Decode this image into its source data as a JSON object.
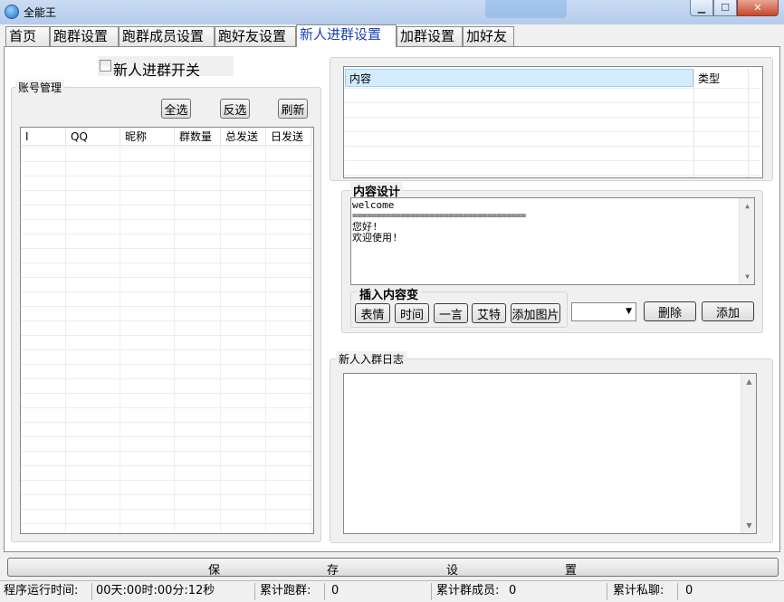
{
  "window": {
    "title": "全能王",
    "min_label": "▁",
    "max_label": "☐",
    "close_label": "✕"
  },
  "tabs": [
    {
      "label": "首页"
    },
    {
      "label": "跑群设置"
    },
    {
      "label": "跑群成员设置"
    },
    {
      "label": "跑好友设置"
    },
    {
      "label": "新人进群设置"
    },
    {
      "label": "加群设置"
    },
    {
      "label": "加好友"
    }
  ],
  "active_tab": "新人进群设置",
  "switch": {
    "label": "新人进群开关",
    "checked": false
  },
  "account": {
    "legend": "账号管理",
    "select_all": "全选",
    "invert": "反选",
    "refresh": "刷新",
    "columns": [
      "I",
      "QQ",
      "昵称",
      "群数量",
      "总发送",
      "日发送"
    ]
  },
  "content_table": {
    "columns": [
      "内容",
      "类型"
    ]
  },
  "design": {
    "legend": "内容设计",
    "text_lines": [
      "welcome",
      "====================================",
      "您好!",
      "欢迎使用!"
    ],
    "insert_legend": "插入内容变",
    "insert_buttons": [
      "表情",
      "时间",
      "一言",
      "艾特",
      "添加图片"
    ],
    "select_value": "",
    "delete": "删除",
    "add": "添加"
  },
  "log": {
    "legend": "新人入群日志"
  },
  "save": {
    "chars": [
      "保",
      "存",
      "设",
      "置"
    ]
  },
  "status": {
    "runtime_label": "程序运行时间:",
    "runtime_value": "00天:00时:00分:12秒",
    "groups_label": "累计跑群:",
    "groups_value": "0",
    "members_label": "累计群成员:",
    "members_value": "0",
    "private_label": "累计私聊:",
    "private_value": "0"
  }
}
